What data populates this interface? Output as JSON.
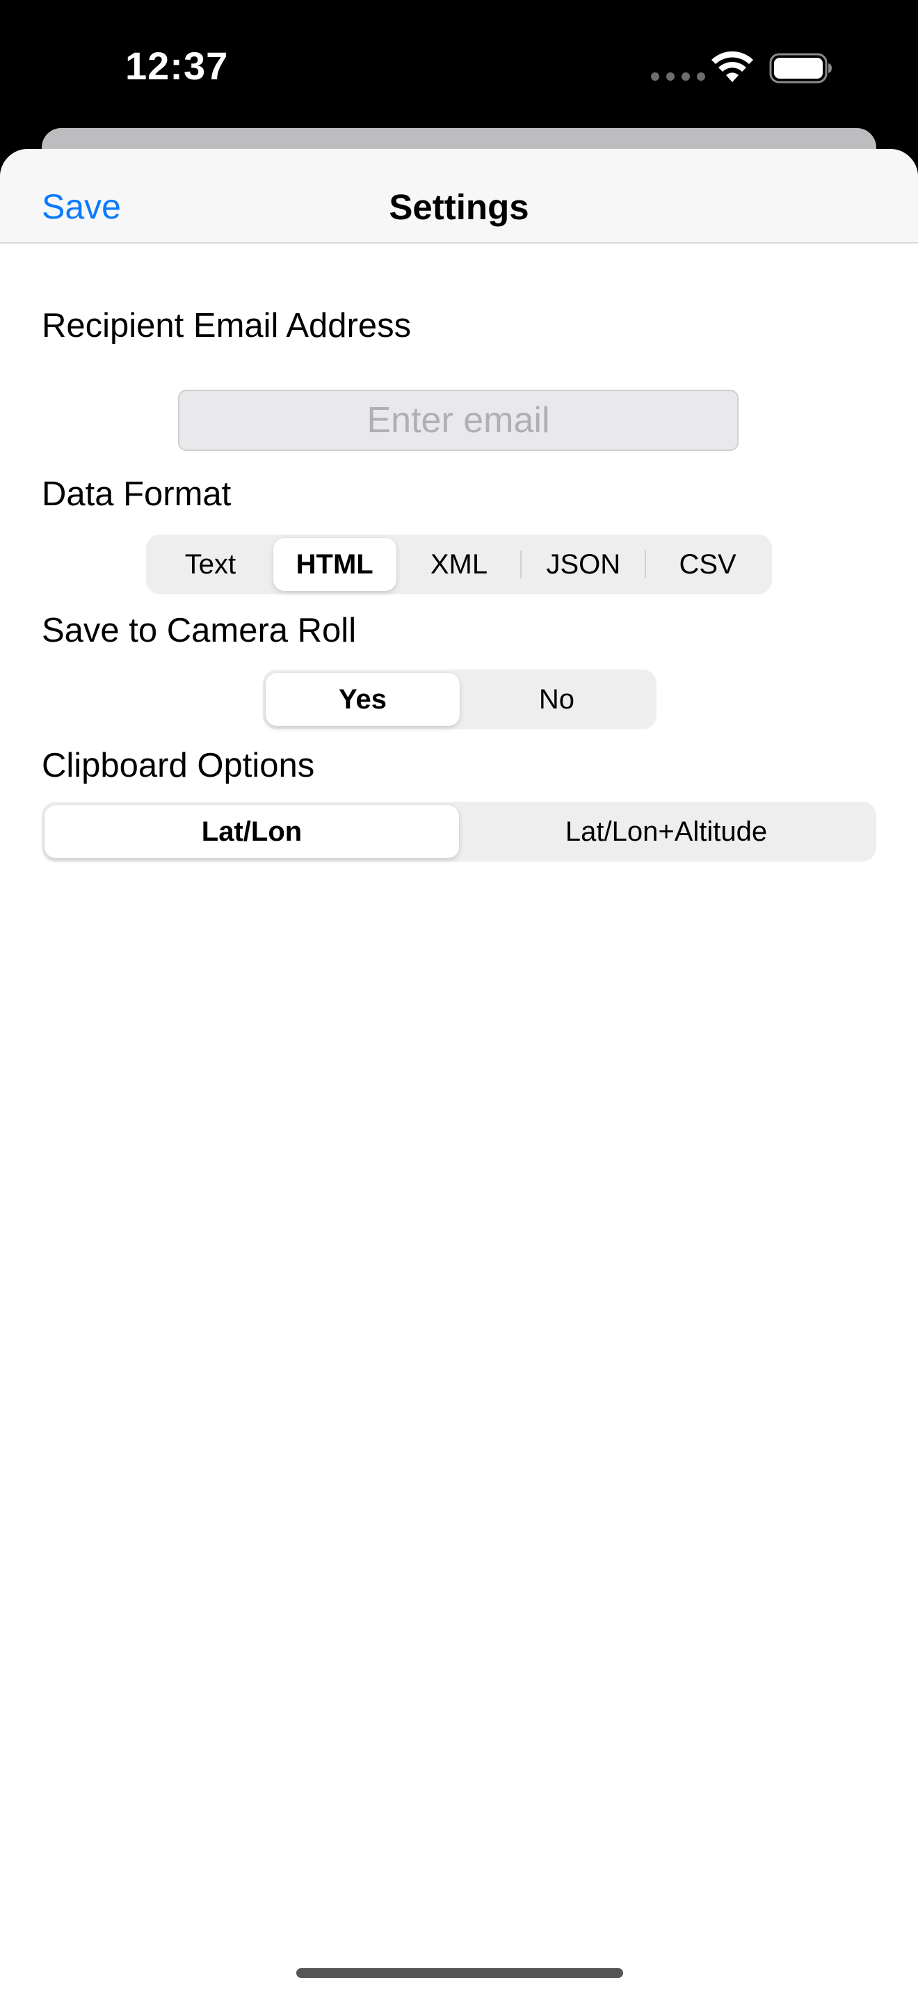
{
  "status_bar": {
    "time": "12:37"
  },
  "nav": {
    "save_label": "Save",
    "title": "Settings"
  },
  "email": {
    "label": "Recipient Email Address",
    "placeholder": "Enter email",
    "value": ""
  },
  "data_format": {
    "label": "Data Format",
    "options": [
      "Text",
      "HTML",
      "XML",
      "JSON",
      "CSV"
    ],
    "selected": "HTML"
  },
  "camera_roll": {
    "label": "Save to Camera Roll",
    "options": [
      "Yes",
      "No"
    ],
    "selected": "Yes"
  },
  "clipboard": {
    "label": "Clipboard Options",
    "options": [
      "Lat/Lon",
      "Lat/Lon+Altitude"
    ],
    "selected": "Lat/Lon"
  },
  "colors": {
    "accent": "#0a7aff",
    "segment_track": "#eeeeef",
    "sheet": "#ffffff"
  },
  "icons": [
    "signal-icon",
    "wifi-icon",
    "battery-icon"
  ]
}
